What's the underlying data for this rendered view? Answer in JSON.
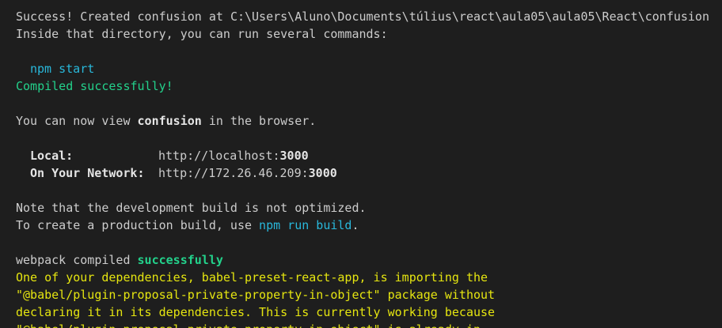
{
  "terminal": {
    "success_prefix": "Success! Created confusion at ",
    "success_path": "C:\\Users\\Aluno\\Documents\\túlius\\react\\aula05\\aula05\\React\\confusion",
    "inside_dir": "Inside that directory, you can run several commands:",
    "npm_start": "npm start",
    "compiled_ok": "Compiled successfully!",
    "view_prefix": "You can now view ",
    "view_app": "confusion",
    "view_suffix": " in the browser.",
    "local_label": "Local:",
    "local_url_prefix": "http://localhost:",
    "local_port": "3000",
    "network_label": "On Your Network:",
    "network_url_prefix": "http://172.26.46.209:",
    "network_port": "3000",
    "note_line": "Note that the development build is not optimized.",
    "build_prefix": "To create a production build, use ",
    "build_cmd": "npm run build",
    "build_suffix": ".",
    "webpack_prefix": "webpack compiled ",
    "webpack_status": "successfully",
    "warn_1": "One of your dependencies, babel-preset-react-app, is importing the",
    "warn_2": "\"@babel/plugin-proposal-private-property-in-object\" package without",
    "warn_3": "declaring it in its dependencies. This is currently working because",
    "warn_4": "\"@babel/plugin-proposal-private-property-in-object\" is already in"
  },
  "colors": {
    "background": "#1e1e1e",
    "text": "#cccccc",
    "cyan": "#29b8db",
    "green": "#23d18b",
    "yellow": "#e5e510"
  }
}
